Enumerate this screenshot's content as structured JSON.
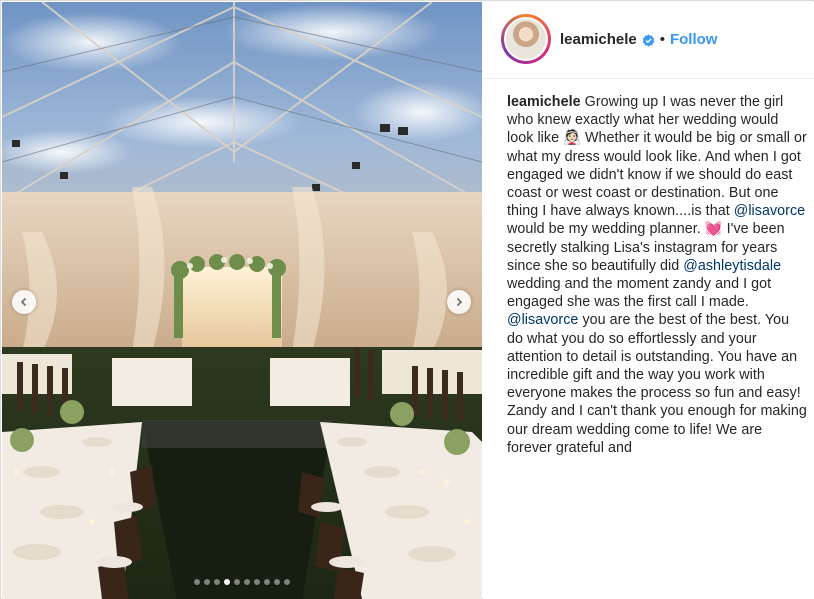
{
  "post": {
    "username": "leamichele",
    "separator": "•",
    "follow_label": "Follow",
    "caption_parts": [
      {
        "kind": "user",
        "text": "leamichele"
      },
      {
        "kind": "text",
        "text": " Growing up I was never the girl who knew exactly what her wedding would look like "
      },
      {
        "kind": "emoji",
        "text": "👰🏻"
      },
      {
        "kind": "text",
        "text": " Whether it would be big or small or what my dress would look like. And when I got engaged we didn't know if we should do east coast or west coast or destination. But one thing I have always known....is that "
      },
      {
        "kind": "mention",
        "text": "@lisavorce"
      },
      {
        "kind": "text",
        "text": " would be my wedding planner. "
      },
      {
        "kind": "heart",
        "text": "💓"
      },
      {
        "kind": "text",
        "text": " I've been secretly stalking Lisa's instagram for years since she so beautifully did "
      },
      {
        "kind": "mention",
        "text": "@ashleytisdale"
      },
      {
        "kind": "text",
        "text": " wedding and the moment zandy and I got engaged she was the first call I made. "
      },
      {
        "kind": "mention",
        "text": "@lisavorce"
      },
      {
        "kind": "text",
        "text": " you are the best of the best. You do what you do so effortlessly and your attention to detail is outstanding. You have an incredible gift and the way you work with everyone makes the process so fun and easy! Zandy and I can't thank you enough for making our dream wedding come to life! We are forever grateful and",
        "truncated_note": ""
      }
    ]
  },
  "carousel": {
    "total_slides": 10,
    "active_index": 3,
    "prev_icon": "chevron-left-icon",
    "next_icon": "chevron-right-icon"
  },
  "colors": {
    "follow": "#3897f0",
    "mention": "#003569",
    "text": "#262626",
    "border": "#dbdbdb"
  }
}
